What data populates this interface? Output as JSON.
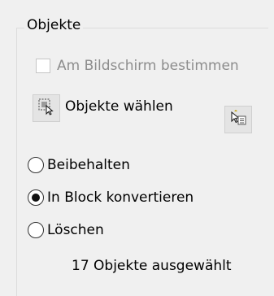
{
  "group": {
    "title": "Objekte"
  },
  "checkbox_screen": {
    "label": "Am Bildschirm bestimmen",
    "checked": false,
    "enabled": false
  },
  "select_objects": {
    "label": "Objekte wählen",
    "left_icon": "select-objects-icon",
    "right_icon": "quick-select-icon"
  },
  "radios": [
    {
      "label": "Beibehalten",
      "selected": false
    },
    {
      "label": "In Block konvertieren",
      "selected": true
    },
    {
      "label": "Löschen",
      "selected": false
    }
  ],
  "status": {
    "text": "17 Objekte ausgewählt"
  }
}
